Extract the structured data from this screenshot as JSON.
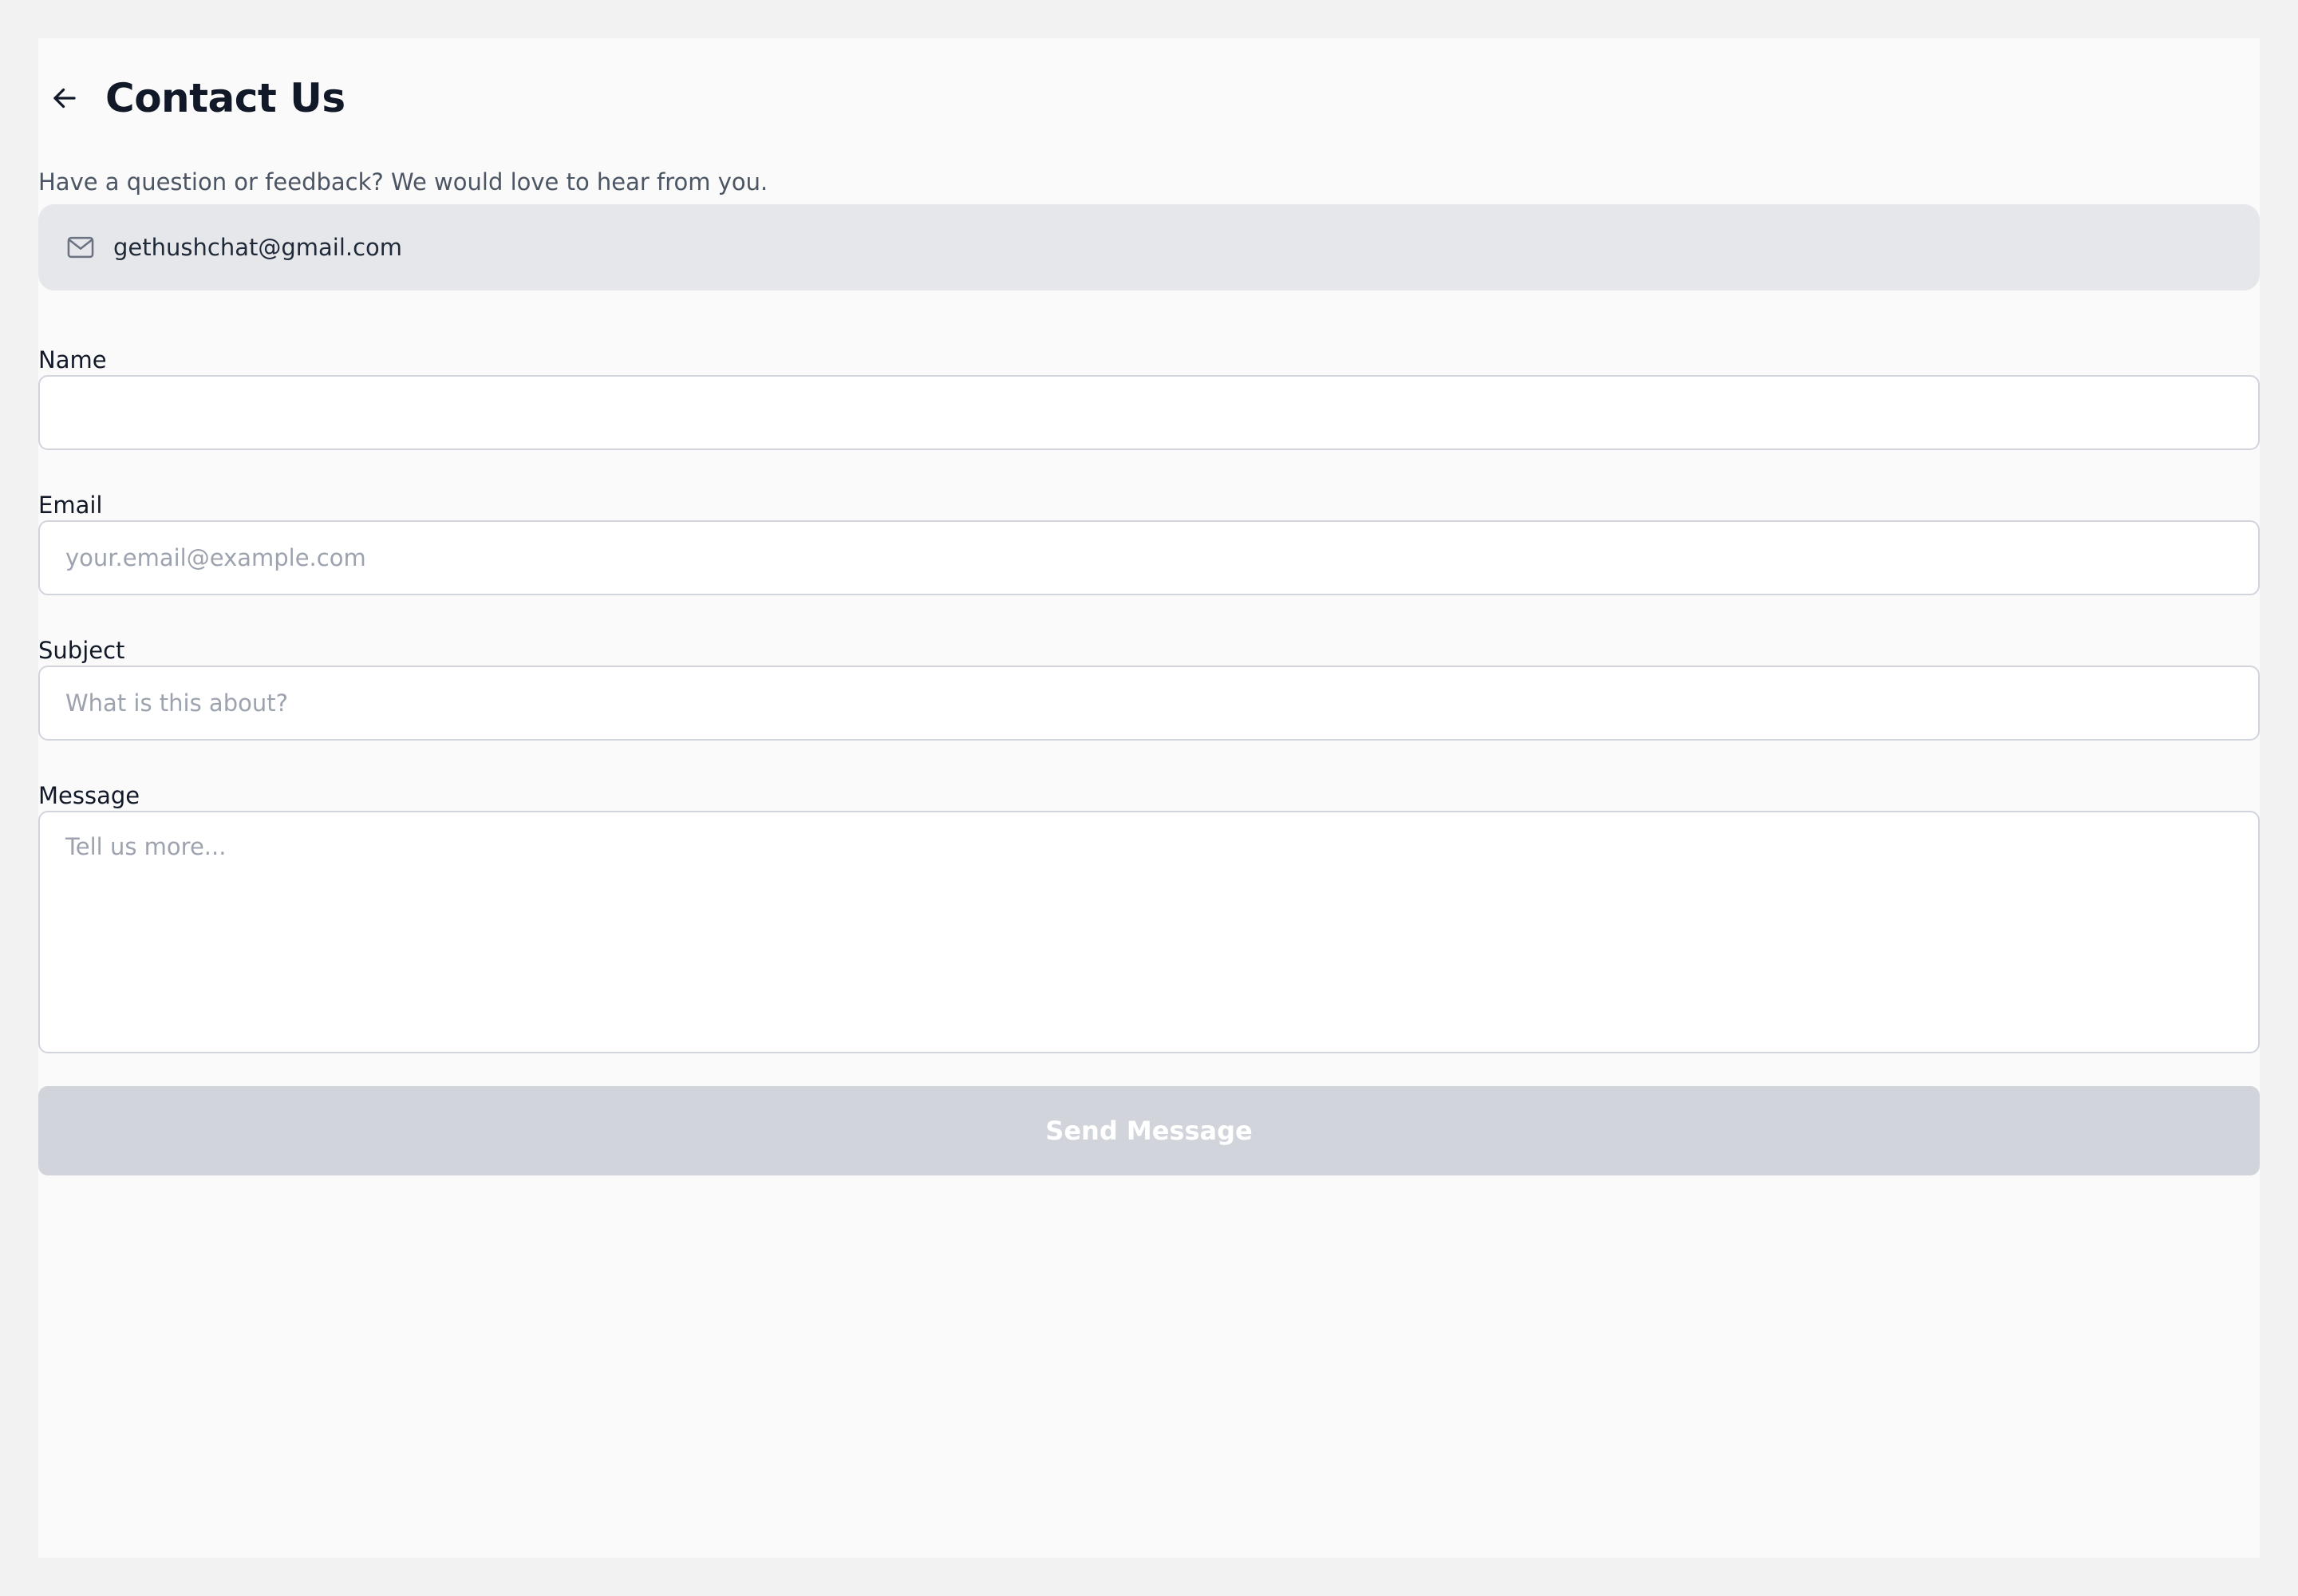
{
  "header": {
    "title": "Contact Us",
    "subtitle": "Have a question or feedback? We would love to hear from you.",
    "back_icon": "arrow-left-icon"
  },
  "contact_email": {
    "icon": "mail-icon",
    "address": "gethushchat@gmail.com"
  },
  "form": {
    "name": {
      "label": "Name",
      "value": "",
      "placeholder": ""
    },
    "email": {
      "label": "Email",
      "value": "",
      "placeholder": "your.email@example.com"
    },
    "subject": {
      "label": "Subject",
      "value": "",
      "placeholder": "What is this about?"
    },
    "message": {
      "label": "Message",
      "value": "",
      "placeholder": "Tell us more..."
    },
    "submit_label": "Send Message",
    "submit_disabled": true
  },
  "colors": {
    "page_background": "#fafafa",
    "outer_background": "#f2f2f2",
    "email_card": "#e5e7eb",
    "button_disabled": "#d1d5db",
    "placeholder": "#9ca3af",
    "text_primary": "#111827",
    "text_secondary": "#4b5563"
  }
}
